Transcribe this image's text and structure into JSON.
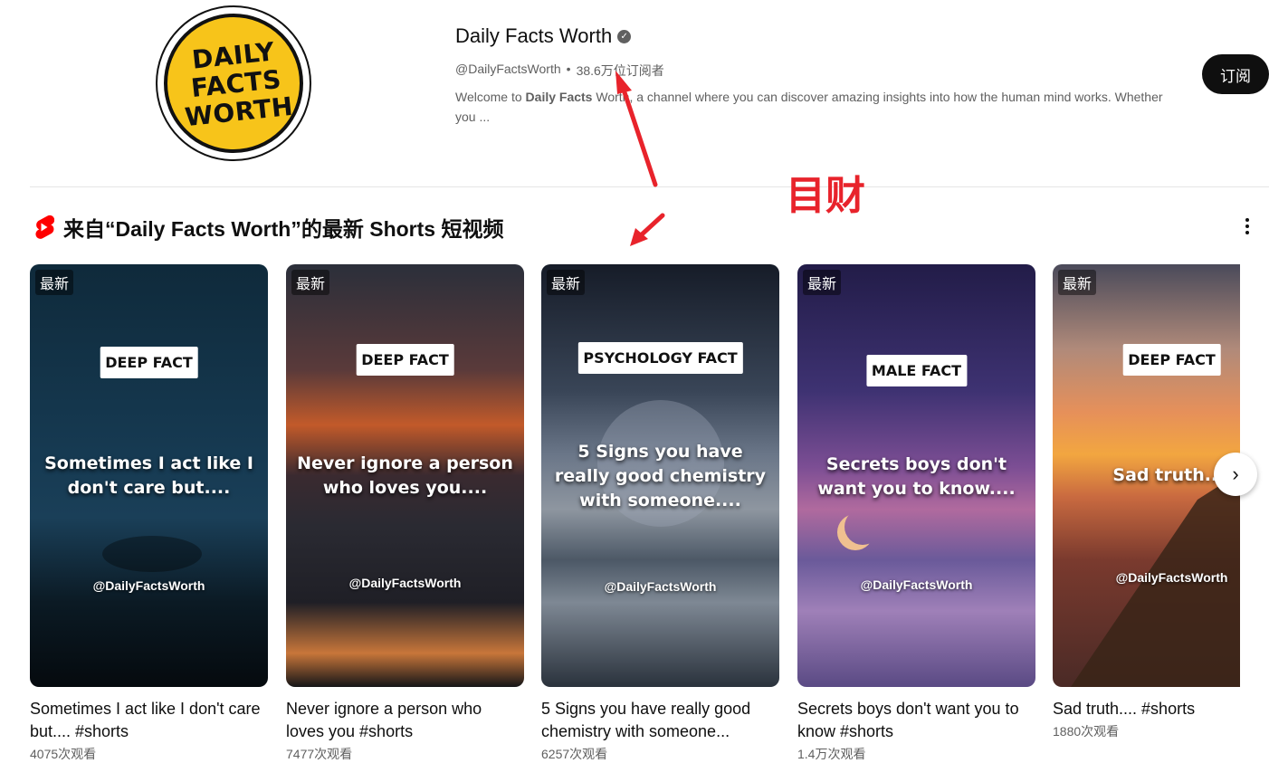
{
  "channel": {
    "logo_lines": [
      "DAILY",
      "FACTS",
      "WORTH"
    ],
    "name": "Daily Facts Worth",
    "verified_icon": "verified-check-icon",
    "handle": "@DailyFactsWorth",
    "separator": "•",
    "subscribers": "38.6万位订阅者",
    "description_prefix": "Welcome to ",
    "description_bold": "Daily Facts",
    "description_suffix": " Worth, a channel where you can discover amazing insights into how the human mind works. Whether you ...",
    "subscribe_label": "订阅"
  },
  "annotation": {
    "text": "目财",
    "color": "#e8232b"
  },
  "shelf": {
    "icon": "youtube-shorts-icon",
    "title": "来自“Daily Facts Worth”的最新 Shorts 短视频",
    "more_icon": "more-vert-icon",
    "next_icon": "chevron-right-icon",
    "next_glyph": "›"
  },
  "cards": [
    {
      "badge": "最新",
      "label": "DEEP FACT",
      "caption": "Sometimes I act like I don't care but....",
      "handle": "@DailyFactsWorth",
      "title": "Sometimes I act like I don't care but.... #shorts",
      "views": "4075次观看"
    },
    {
      "badge": "最新",
      "label": "DEEP FACT",
      "caption": "Never ignore a person who loves you....",
      "handle": "@DailyFactsWorth",
      "title": "Never ignore a person who loves you #shorts",
      "views": "7477次观看"
    },
    {
      "badge": "最新",
      "label": "PSYCHOLOGY FACT",
      "caption": "5 Signs you have really good chemistry with someone....",
      "handle": "@DailyFactsWorth",
      "title": "5 Signs you have really good chemistry with someone...",
      "views": "6257次观看"
    },
    {
      "badge": "最新",
      "label": "MALE FACT",
      "caption": "Secrets boys don't want you to know....",
      "handle": "@DailyFactsWorth",
      "title": "Secrets boys don't want you to know #shorts",
      "views": "1.4万次观看"
    },
    {
      "badge": "最新",
      "label": "DEEP FACT",
      "caption": "Sad truth....",
      "handle": "@DailyFactsWorth",
      "title": "Sad truth.... #shorts",
      "views": "1880次观看"
    }
  ]
}
